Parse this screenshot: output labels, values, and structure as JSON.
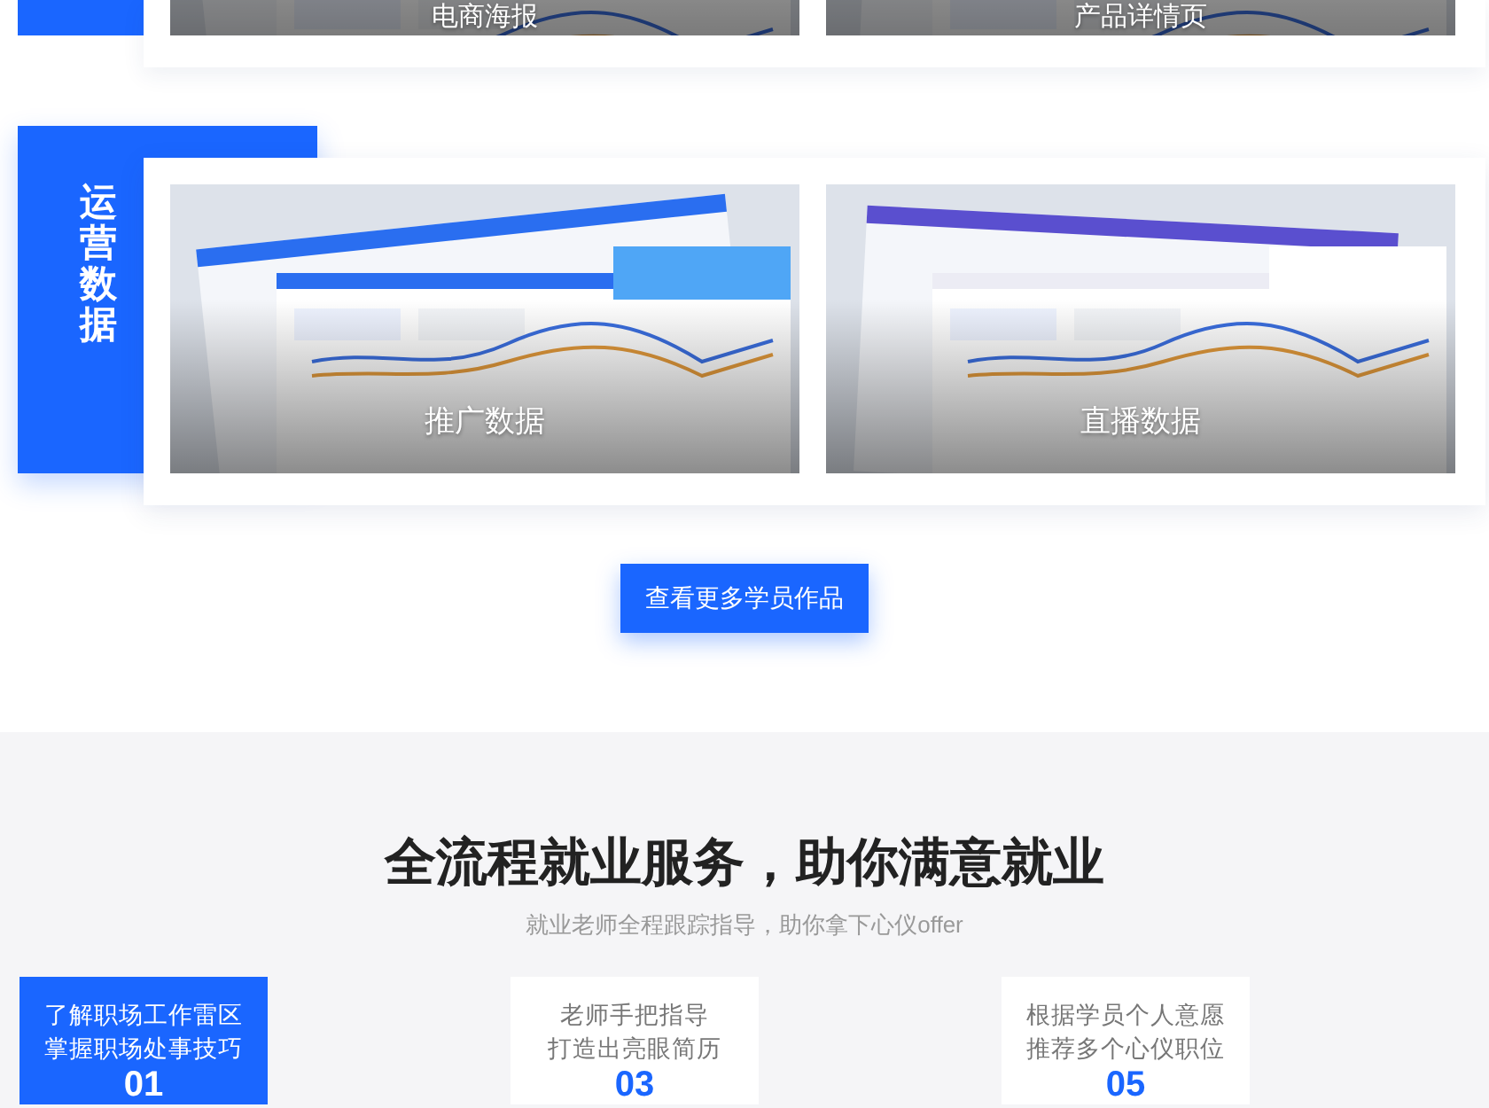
{
  "top_works": [
    {
      "caption": "电商海报"
    },
    {
      "caption": "产品详情页"
    }
  ],
  "section": {
    "label": "运营数据",
    "works": [
      {
        "caption": "推广数据"
      },
      {
        "caption": "直播数据"
      }
    ]
  },
  "more_button": "查看更多学员作品",
  "service": {
    "title": "全流程就业服务，助你满意就业",
    "subtitle": "就业老师全程跟踪指导，助你拿下心仪offer",
    "steps": [
      {
        "lines": [
          "了解职场工作雷区",
          "掌握职场处事技巧"
        ],
        "number": "01",
        "selected": true
      },
      {
        "lines": [
          "老师手把指导",
          "打造出亮眼简历"
        ],
        "number": "03",
        "selected": false
      },
      {
        "lines": [
          "根据学员个人意愿",
          "推荐多个心仪职位"
        ],
        "number": "05",
        "selected": false
      }
    ]
  }
}
